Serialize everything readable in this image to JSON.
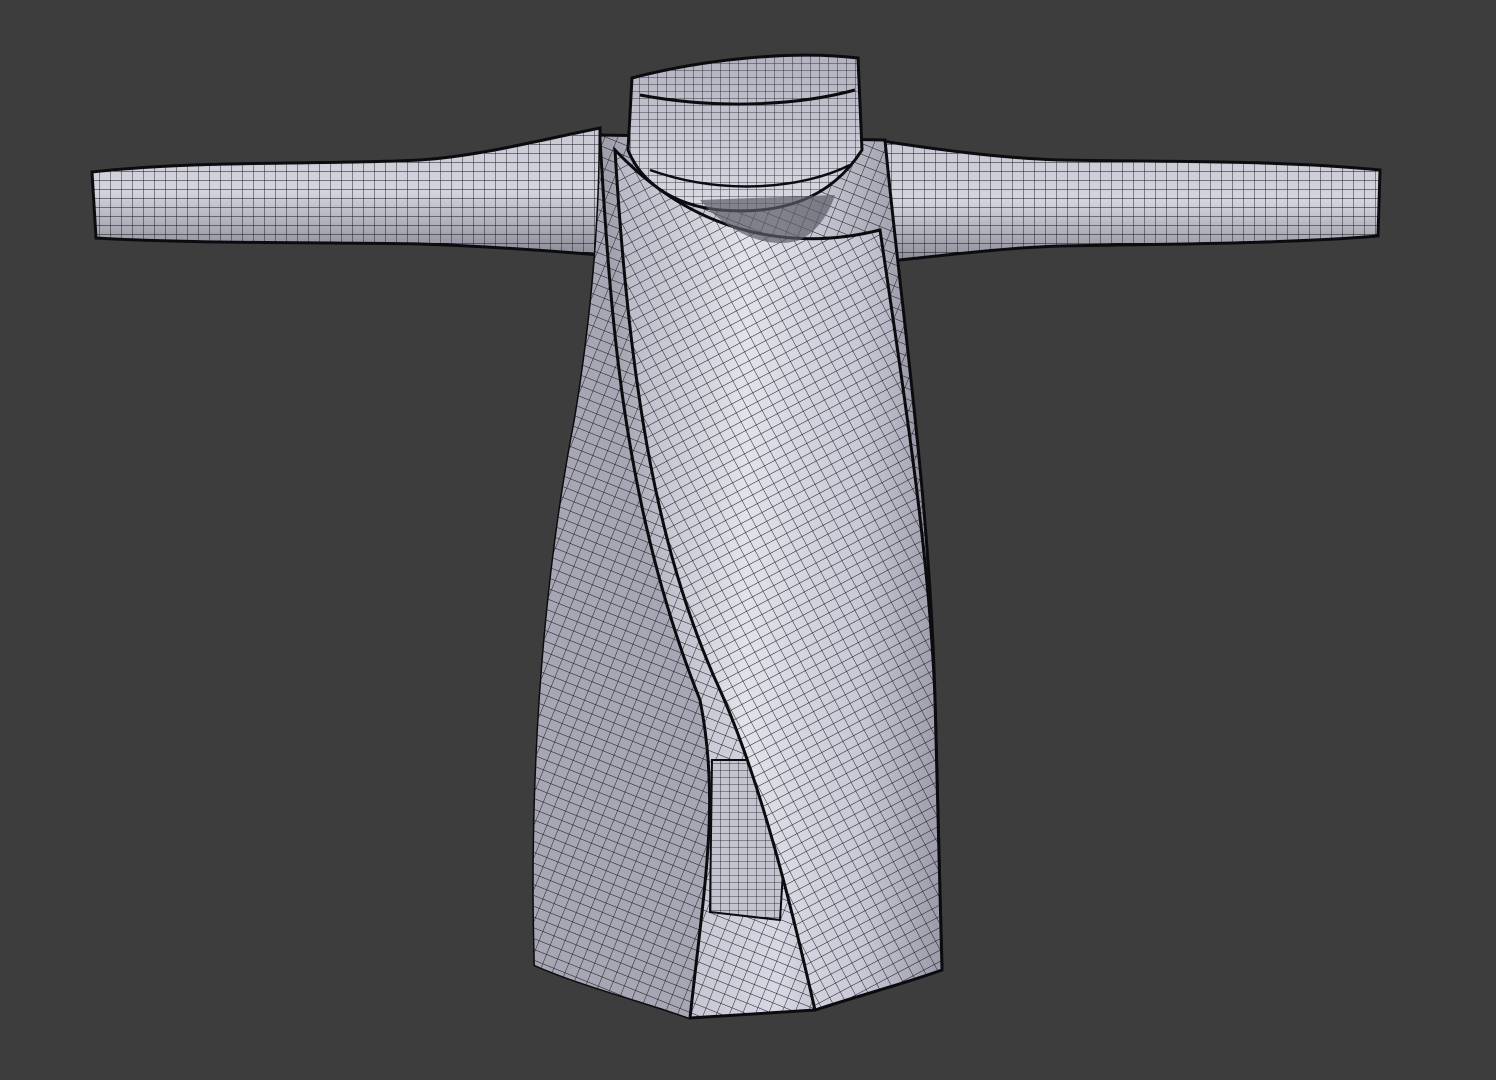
{
  "viewport": {
    "background": "#3d3d3d",
    "shading": "solid",
    "overlay": "wireframe"
  },
  "mesh": {
    "object": "coat-garment-mesh",
    "parts": [
      "left-sleeve",
      "right-sleeve",
      "collar",
      "body-back-panel",
      "inner-front-panel",
      "front-overlap-panel"
    ],
    "colors": {
      "surface_light": "#d6d6e0",
      "surface_mid": "#a8a8b6",
      "surface_dark": "#6e6e7a",
      "wire": "#141418"
    }
  }
}
